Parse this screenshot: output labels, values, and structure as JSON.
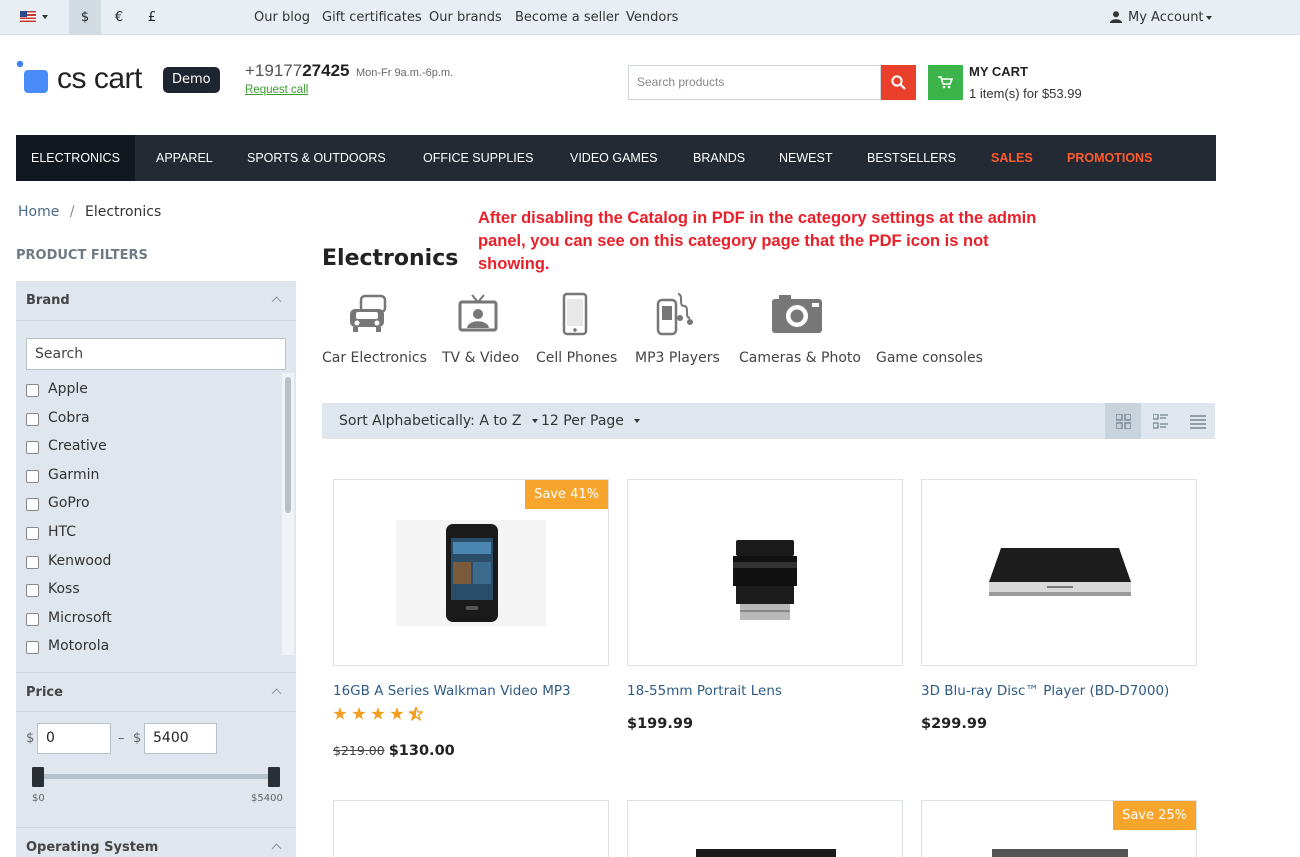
{
  "topbar": {
    "currencies": [
      "$",
      "€",
      "£"
    ],
    "links": [
      "Our blog",
      "Gift certificates",
      "Our brands",
      "Become a seller",
      "Vendors"
    ],
    "account": "My Account"
  },
  "header": {
    "logo": "cs cart",
    "demo_badge": "Demo",
    "phone_prefix": "+19177",
    "phone_suffix": "27425",
    "hours": "Mon-Fr 9a.m.-6p.m.",
    "request_call": "Request call",
    "search_placeholder": "Search products",
    "cart_title": "MY CART",
    "cart_summary": "1 item(s) for $53.99"
  },
  "nav": [
    "ELECTRONICS",
    "APPAREL",
    "SPORTS & OUTDOORS",
    "OFFICE SUPPLIES",
    "VIDEO GAMES",
    "BRANDS",
    "NEWEST",
    "BESTSELLERS",
    "SALES",
    "PROMOTIONS"
  ],
  "breadcrumb": {
    "home": "Home",
    "sep": "/",
    "current": "Electronics"
  },
  "annotation": "After disabling the Catalog in PDF in the category settings at the admin panel, you can see on this category page that the PDF icon is not showing.",
  "filters": {
    "title": "PRODUCT FILTERS",
    "brand": {
      "title": "Brand",
      "search_placeholder": "Search",
      "items": [
        "Apple",
        "Cobra",
        "Creative",
        "Garmin",
        "GoPro",
        "HTC",
        "Kenwood",
        "Koss",
        "Microsoft",
        "Motorola"
      ]
    },
    "price": {
      "title": "Price",
      "currency": "$",
      "dash": "–",
      "min": "0",
      "max": "5400",
      "min_label": "$0",
      "max_label": "$5400"
    },
    "os": {
      "title": "Operating System"
    }
  },
  "category": {
    "title": "Electronics",
    "subcategories": [
      "Car Electronics",
      "TV & Video",
      "Cell Phones",
      "MP3 Players",
      "Cameras & Photo",
      "Game consoles"
    ]
  },
  "sort": {
    "sort_label": "Sort Alphabetically: A to Z",
    "per_page": "12 Per Page"
  },
  "products": [
    {
      "name": "16GB A Series Walkman Video MP3",
      "badge": "Save 41%",
      "old_price": "$219.00",
      "price": "$130.00",
      "rating": 4.5
    },
    {
      "name": "18-55mm Portrait Lens",
      "price": "$199.99"
    },
    {
      "name": "3D Blu-ray Disc™ Player (BD-D7000)",
      "price": "$299.99"
    }
  ],
  "next_row_badge": "Save 25%",
  "colors": {
    "accent_red": "#e8402a",
    "cart_green": "#3cb44a",
    "nav_bg": "#232a33",
    "sale_badge": "#f7a52c",
    "annotation_red": "#e8202a"
  }
}
